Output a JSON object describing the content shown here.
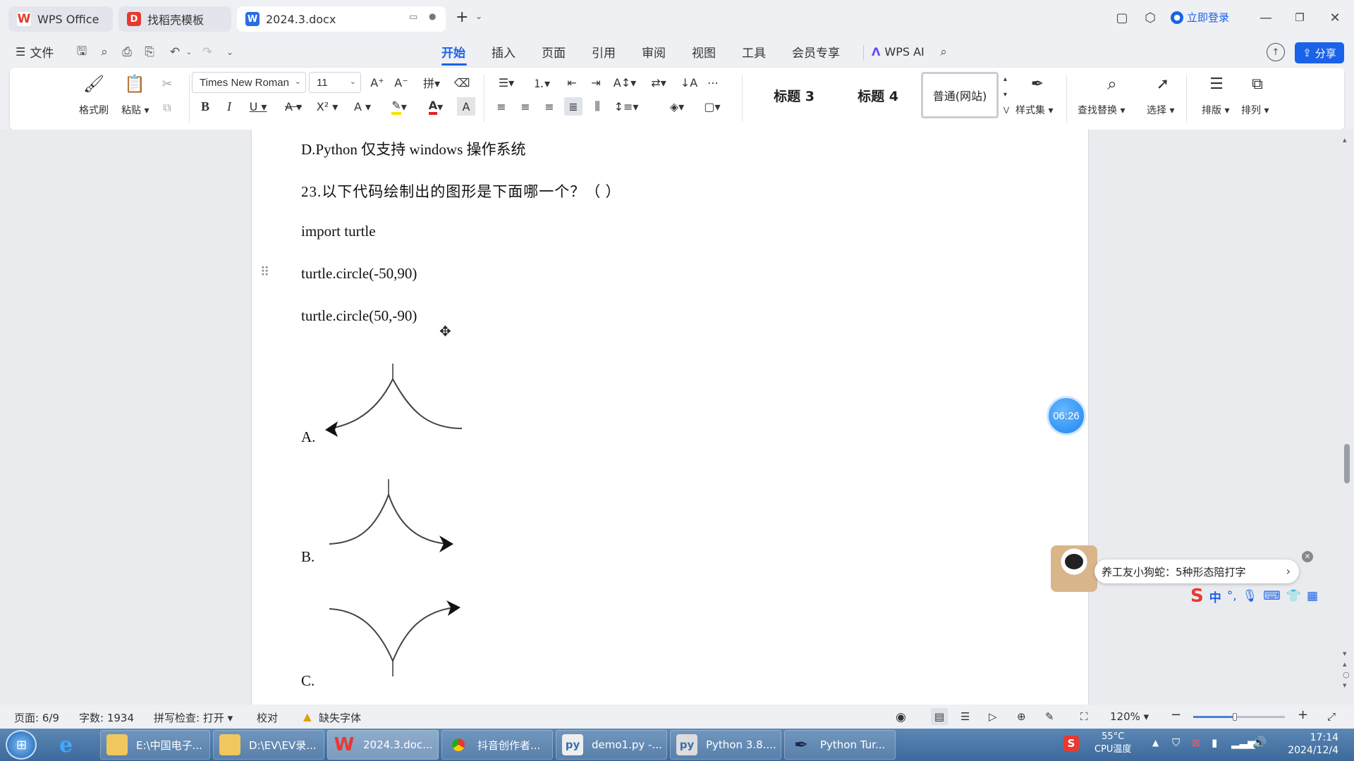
{
  "titlebar": {
    "tabs": [
      {
        "label": "WPS Office",
        "icon": "wps-icon"
      },
      {
        "label": "找稻壳模板",
        "icon": "docer-icon"
      },
      {
        "label": "2024.3.docx",
        "icon": "word-doc-icon"
      }
    ],
    "login_label": "立即登录"
  },
  "menubar": {
    "file_label": "文件",
    "tabs": [
      "开始",
      "插入",
      "页面",
      "引用",
      "审阅",
      "视图",
      "工具",
      "会员专享"
    ],
    "active_tab": "开始",
    "wps_ai_label": "WPS AI",
    "share_label": "分享"
  },
  "ribbon": {
    "format_painter_label": "格式刷",
    "paste_label": "粘贴",
    "font_name": "Times New Roman",
    "font_size": "11",
    "styles": [
      "标题 3",
      "标题 4",
      "普通(网站)"
    ],
    "styles_set_label": "样式集",
    "find_replace_label": "查找替换",
    "select_label": "选择",
    "layout_label": "排版",
    "arrange_label": "排列"
  },
  "document": {
    "lines": [
      "D.Python 仅支持 windows 操作系统",
      "23.以下代码绘制出的图形是下面哪一个？（    ）",
      "import turtle",
      "turtle.circle(-50,90)",
      "turtle.circle(50,-90)"
    ],
    "options": [
      "A.",
      "B.",
      "C."
    ]
  },
  "timer": "06:26",
  "ime": {
    "popup_text": "养工友小狗蛇：5种形态陪打字",
    "mode_label": "中"
  },
  "statusbar": {
    "page": "页面: 6/9",
    "words": "字数: 1934",
    "spell": "拼写检查: 打开",
    "proof": "校对",
    "missing_font": "缺失字体",
    "zoom": "120%",
    "zoom_fraction": 0.45
  },
  "taskbar": {
    "items": [
      {
        "label": "E:\\中国电子...",
        "icon": "folder-icon"
      },
      {
        "label": "D:\\EV\\EV录...",
        "icon": "folder-icon"
      },
      {
        "label": "2024.3.doc...",
        "icon": "wps-icon"
      },
      {
        "label": "抖音创作者...",
        "icon": "chrome-icon"
      },
      {
        "label": "demo1.py -...",
        "icon": "python-file-icon"
      },
      {
        "label": "Python 3.8....",
        "icon": "python-icon"
      },
      {
        "label": "Python Tur...",
        "icon": "turtle-feather-icon"
      }
    ],
    "temp": "55°C",
    "temp_label": "CPU温度",
    "time": "17:14",
    "date": "2024/12/4"
  },
  "colors": {
    "accent": "#1a62e8",
    "wps_red": "#e8382f",
    "share_bg": "#1a62e8"
  }
}
